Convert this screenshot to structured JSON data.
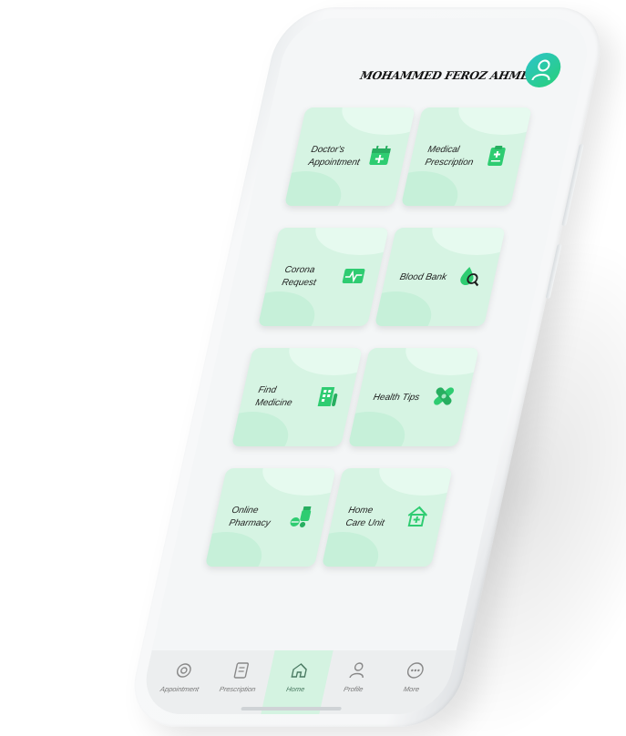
{
  "user": {
    "name": "MOHAMMED FEROZ AHMED"
  },
  "tiles": [
    {
      "line1": "Doctor's",
      "line2": "Appointment",
      "icon": "calendar-plus-icon"
    },
    {
      "line1": "Medical",
      "line2": "Prescription",
      "icon": "clipboard-plus-icon"
    },
    {
      "line1": "Corona",
      "line2": "Request",
      "icon": "heartbeat-monitor-icon"
    },
    {
      "line1": "Blood Bank",
      "line2": "",
      "icon": "blood-drop-search-icon"
    },
    {
      "line1": "Find",
      "line2": "Medicine",
      "icon": "pharmacy-building-icon"
    },
    {
      "line1": "Health Tips",
      "line2": "",
      "icon": "bandage-icon"
    },
    {
      "line1": "Online",
      "line2": "Pharmacy",
      "icon": "pills-bottle-icon"
    },
    {
      "line1": "Home",
      "line2": "Care Unit",
      "icon": "home-medical-icon"
    }
  ],
  "nav": [
    {
      "label": "Appointment",
      "icon": "stethoscope-icon"
    },
    {
      "label": "Prescription",
      "icon": "prescription-icon"
    },
    {
      "label": "Home",
      "icon": "home-icon",
      "active": true
    },
    {
      "label": "Profile",
      "icon": "user-icon"
    },
    {
      "label": "More",
      "icon": "more-dots-icon"
    }
  ],
  "colors": {
    "accent": "#2ecc71",
    "tile_bg": "#d6f4e3",
    "avatar_gradient_start": "#2cc4c8",
    "avatar_gradient_end": "#28d07a"
  }
}
